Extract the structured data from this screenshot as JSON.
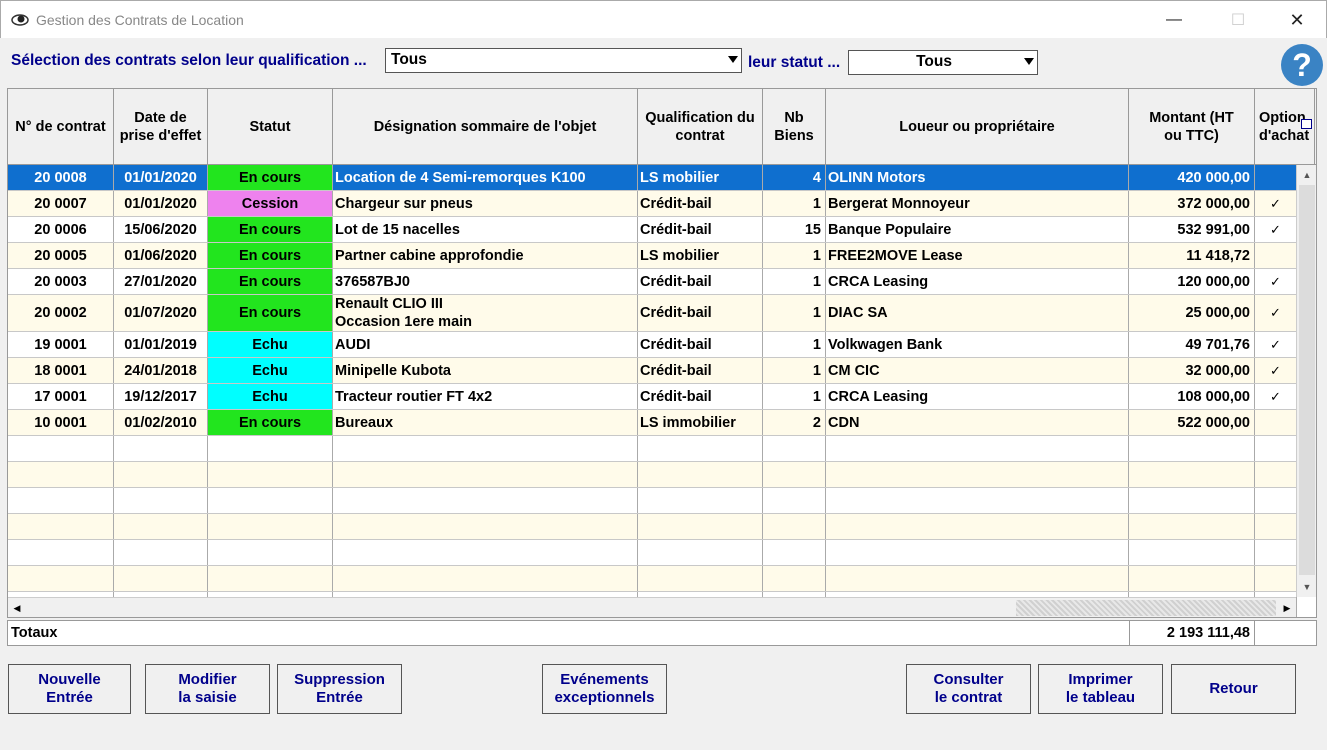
{
  "window": {
    "title": "Gestion des Contrats de Location",
    "minimize": "—",
    "maximize": "☐",
    "close": "✕"
  },
  "filters": {
    "qualification_label": "Sélection des contrats selon leur qualification ...",
    "qualification_value": "Tous",
    "status_label": "leur statut ...",
    "status_value": "Tous",
    "help_label": "?"
  },
  "table": {
    "headers": {
      "num": "N° de contrat",
      "date": "Date de prise d'effet",
      "statut": "Statut",
      "designation": "Désignation sommaire de l'objet",
      "qualification": "Qualification du contrat",
      "nb": "Nb Biens",
      "loueur": "Loueur ou propriétaire",
      "montant": "Montant (HT ou TTC)",
      "option": "Option d'achat"
    },
    "rows": [
      {
        "num": "20 0008",
        "date": "01/01/2020",
        "statut": "En cours",
        "designation": "Location de 4 Semi-remorques K100",
        "designation2": "",
        "qualification": "LS mobilier",
        "nb": "4",
        "loueur": "OLINN Motors",
        "montant": "420 000,00",
        "option": ""
      },
      {
        "num": "20 0007",
        "date": "01/01/2020",
        "statut": "Cession",
        "designation": "Chargeur sur pneus",
        "designation2": "",
        "qualification": "Crédit-bail",
        "nb": "1",
        "loueur": "Bergerat Monnoyeur",
        "montant": "372 000,00",
        "option": "✓"
      },
      {
        "num": "20 0006",
        "date": "15/06/2020",
        "statut": "En cours",
        "designation": "Lot de 15 nacelles",
        "designation2": "",
        "qualification": "Crédit-bail",
        "nb": "15",
        "loueur": "Banque Populaire",
        "montant": "532 991,00",
        "option": "✓"
      },
      {
        "num": "20 0005",
        "date": "01/06/2020",
        "statut": "En cours",
        "designation": "Partner cabine approfondie",
        "designation2": "",
        "qualification": "LS mobilier",
        "nb": "1",
        "loueur": "FREE2MOVE Lease",
        "montant": "11 418,72",
        "option": ""
      },
      {
        "num": "20 0003",
        "date": "27/01/2020",
        "statut": "En cours",
        "designation": "376587BJ0",
        "designation2": "",
        "qualification": "Crédit-bail",
        "nb": "1",
        "loueur": "CRCA Leasing",
        "montant": "120 000,00",
        "option": "✓"
      },
      {
        "num": "20 0002",
        "date": "01/07/2020",
        "statut": "En cours",
        "designation": "Renault CLIO III",
        "designation2": "Occasion 1ere main",
        "qualification": "Crédit-bail",
        "nb": "1",
        "loueur": "DIAC SA",
        "montant": "25 000,00",
        "option": "✓"
      },
      {
        "num": "19 0001",
        "date": "01/01/2019",
        "statut": "Echu",
        "designation": "AUDI",
        "designation2": "",
        "qualification": "Crédit-bail",
        "nb": "1",
        "loueur": "Volkwagen Bank",
        "montant": "49 701,76",
        "option": "✓"
      },
      {
        "num": "18 0001",
        "date": "24/01/2018",
        "statut": "Echu",
        "designation": "Minipelle Kubota",
        "designation2": "",
        "qualification": "Crédit-bail",
        "nb": "1",
        "loueur": "CM CIC",
        "montant": "32 000,00",
        "option": "✓"
      },
      {
        "num": "17 0001",
        "date": "19/12/2017",
        "statut": "Echu",
        "designation": "Tracteur routier FT 4x2",
        "designation2": "",
        "qualification": "Crédit-bail",
        "nb": "1",
        "loueur": "CRCA Leasing",
        "montant": "108 000,00",
        "option": "✓"
      },
      {
        "num": "10 0001",
        "date": "01/02/2010",
        "statut": "En cours",
        "designation": "Bureaux",
        "designation2": "",
        "qualification": "LS immobilier",
        "nb": "2",
        "loueur": "CDN",
        "montant": "522 000,00",
        "option": ""
      }
    ],
    "selected_index": 0,
    "status_colors": {
      "En cours": "#22e51e",
      "Cession": "#ee82ee",
      "Echu": "#00ffff"
    }
  },
  "totals": {
    "label": "Totaux",
    "sum": "2 193 111,48"
  },
  "buttons": {
    "nouvelle": "Nouvelle\nEntrée",
    "modifier": "Modifier\nla saisie",
    "suppression": "Suppression\nEntrée",
    "evenements": "Evénements\nexceptionnels",
    "consulter": "Consulter\nle contrat",
    "imprimer": "Imprimer\nle tableau",
    "retour": "Retour"
  }
}
